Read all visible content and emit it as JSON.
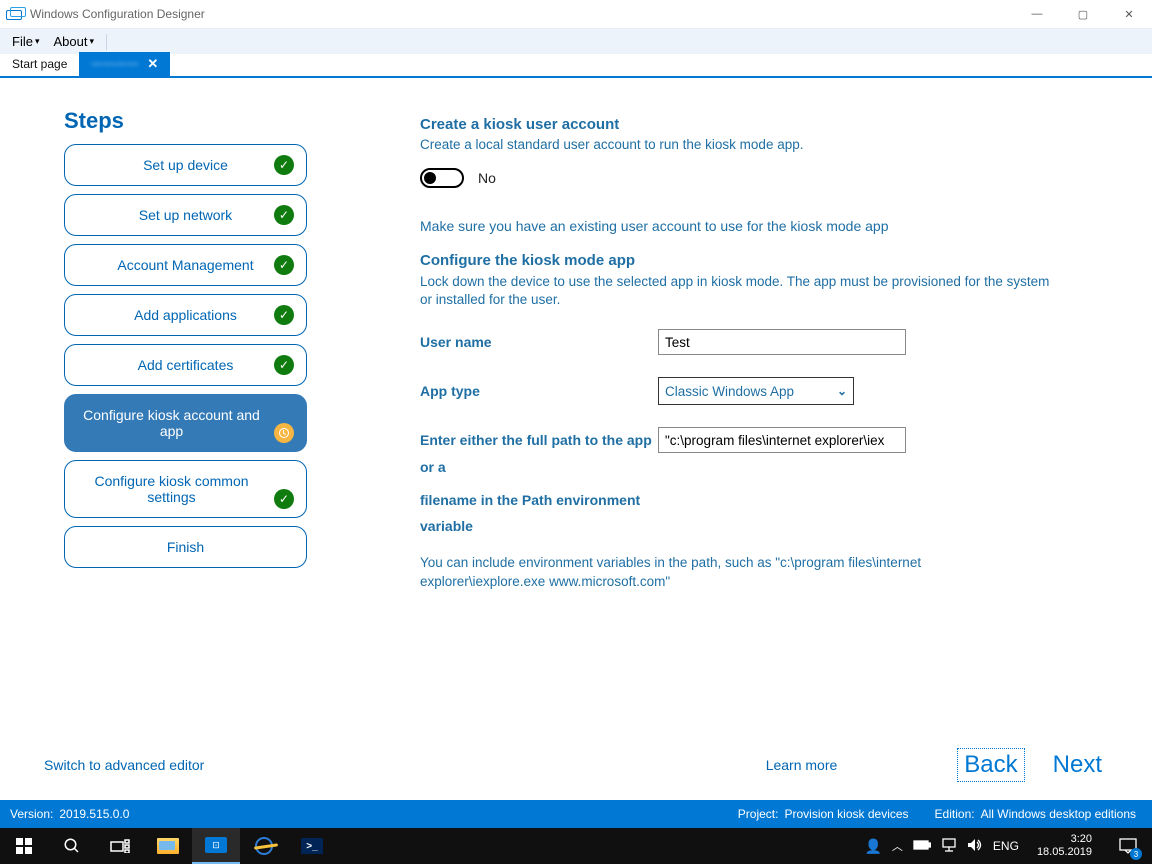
{
  "window": {
    "title": "Windows Configuration Designer",
    "min": "—",
    "max": "▢",
    "close": "✕"
  },
  "menu": {
    "file": "File",
    "about": "About"
  },
  "tabs": {
    "start": "Start page",
    "active_blur": "————",
    "close": "✕"
  },
  "steps": {
    "heading": "Steps",
    "items": [
      {
        "label": "Set up device",
        "done": true
      },
      {
        "label": "Set up network",
        "done": true
      },
      {
        "label": "Account Management",
        "done": true
      },
      {
        "label": "Add applications",
        "done": true
      },
      {
        "label": "Add certificates",
        "done": true
      },
      {
        "label": "Configure kiosk account and app",
        "active": true
      },
      {
        "label": "Configure kiosk common settings",
        "done": true,
        "tall": true
      },
      {
        "label": "Finish"
      }
    ]
  },
  "form": {
    "h1": "Create a kiosk user account",
    "h1_desc": "Create a local standard user account to run the kiosk mode app.",
    "toggle_value": "No",
    "note": "Make sure you have an existing user account to use for the kiosk mode app",
    "h2": "Configure the kiosk mode app",
    "h2_desc": "Lock down the device to use the selected app in kiosk mode. The app must be provisioned for the system or installed for the user.",
    "username_label": "User name",
    "username_value": "Test",
    "apptype_label": "App type",
    "apptype_value": "Classic Windows App",
    "path_label_a": "Enter either the full path to the app or a",
    "path_label_b": "filename in the Path environment variable",
    "path_value": "\"c:\\program files\\internet explorer\\iex",
    "hint": "You can include environment variables in the path, such as \"c:\\program files\\internet explorer\\iexplore.exe www.microsoft.com\""
  },
  "footer": {
    "advanced": "Switch to advanced editor",
    "learn": "Learn more",
    "back": "Back",
    "next": "Next"
  },
  "appstatus": {
    "version_l": "Version:",
    "version_v": "2019.515.0.0",
    "project_l": "Project:",
    "project_v": "Provision kiosk devices",
    "edition_l": "Edition:",
    "edition_v": "All Windows desktop editions"
  },
  "taskbar": {
    "lang": "ENG",
    "time": "3:20",
    "date": "18.05.2019",
    "notif_count": "3"
  }
}
